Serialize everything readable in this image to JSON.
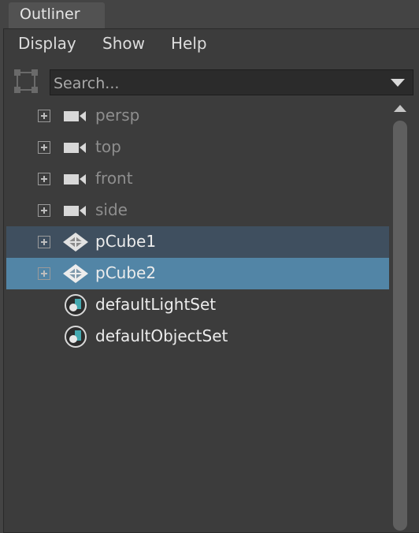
{
  "tab": {
    "title": "Outliner"
  },
  "menu": [
    "Display",
    "Show",
    "Help"
  ],
  "search": {
    "placeholder": "Search..."
  },
  "tree": [
    {
      "label": "persp",
      "icon": "camera-icon",
      "expandable": true,
      "state": "dim"
    },
    {
      "label": "top",
      "icon": "camera-icon",
      "expandable": true,
      "state": "dim"
    },
    {
      "label": "front",
      "icon": "camera-icon",
      "expandable": true,
      "state": "dim"
    },
    {
      "label": "side",
      "icon": "camera-icon",
      "expandable": true,
      "state": "dim"
    },
    {
      "label": "pCube1",
      "icon": "mesh-icon",
      "expandable": true,
      "state": "selected-secondary"
    },
    {
      "label": "pCube2",
      "icon": "mesh-icon",
      "expandable": true,
      "state": "selected"
    },
    {
      "label": "defaultLightSet",
      "icon": "set-icon",
      "expandable": false,
      "state": "normal"
    },
    {
      "label": "defaultObjectSet",
      "icon": "set-icon",
      "expandable": false,
      "state": "normal"
    }
  ],
  "colors": {
    "selected": "#5285a6",
    "selected_secondary": "#3f4f5f",
    "background": "#3c3c3c"
  }
}
